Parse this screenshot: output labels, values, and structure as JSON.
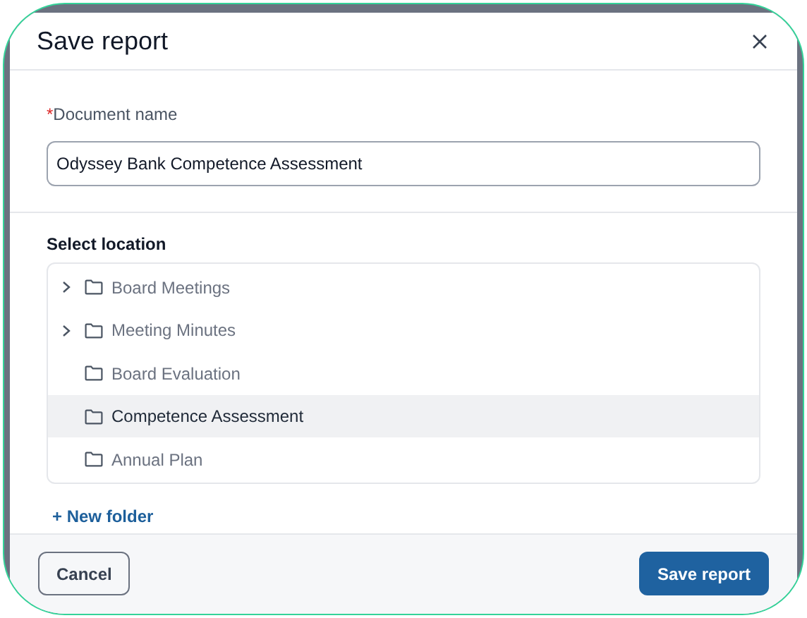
{
  "dialog": {
    "title": "Save report"
  },
  "document_name": {
    "label": "Document name",
    "required_mark": "*",
    "value": "Odyssey Bank Competence Assessment"
  },
  "location": {
    "label": "Select location",
    "folders": [
      {
        "name": "Board Meetings",
        "expandable": true,
        "selected": false
      },
      {
        "name": "Meeting Minutes",
        "expandable": true,
        "selected": false
      },
      {
        "name": "Board Evaluation",
        "expandable": false,
        "selected": false
      },
      {
        "name": "Competence Assessment",
        "expandable": false,
        "selected": true
      },
      {
        "name": "Annual Plan",
        "expandable": false,
        "selected": false
      }
    ]
  },
  "new_folder": "+ New folder",
  "buttons": {
    "cancel": "Cancel",
    "save": "Save report"
  }
}
